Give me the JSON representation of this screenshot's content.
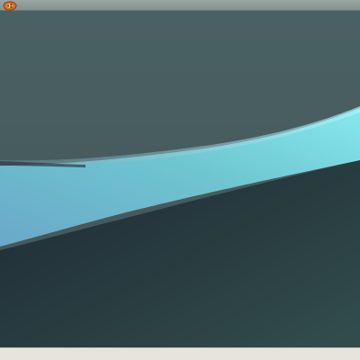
{
  "top_panel": {
    "app_menu_icon": "ubuntu-circle-of-friends-icon"
  },
  "desktop": {
    "wallpaper": "abstract-aqua-wave",
    "colors": {
      "sky_top": "#4a6163",
      "sky_bottom": "#43565a",
      "wave_light": "#86e9ee",
      "wave_mid": "#6ec6d0",
      "wave_left": "#6aa8c9",
      "lower_dark": "#1d2a33",
      "lower_right": "#334d4d"
    }
  },
  "bottom_panel": {
    "background": "#e7e3dd"
  }
}
